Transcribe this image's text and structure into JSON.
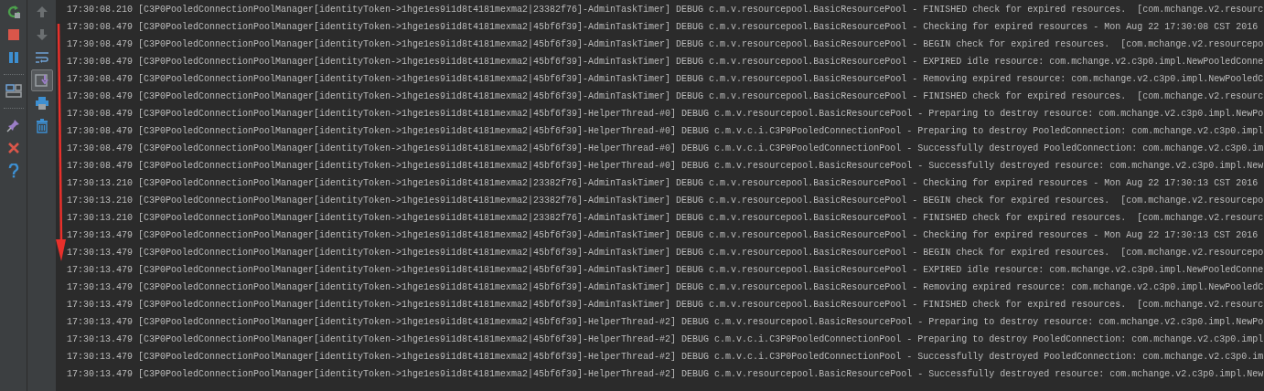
{
  "run_toolbar": [
    {
      "kind": "rerun"
    },
    {
      "kind": "stop"
    },
    {
      "kind": "pause"
    },
    {
      "kind": "separator"
    },
    {
      "kind": "layout"
    },
    {
      "kind": "separator"
    },
    {
      "kind": "pin"
    },
    {
      "kind": "close"
    },
    {
      "kind": "help"
    }
  ],
  "console_toolbar": [
    {
      "kind": "up",
      "disabled": true,
      "selected": false
    },
    {
      "kind": "down",
      "disabled": true,
      "selected": false
    },
    {
      "kind": "wrap",
      "disabled": false,
      "selected": false
    },
    {
      "kind": "scroll_end",
      "disabled": false,
      "selected": true
    },
    {
      "kind": "print",
      "disabled": false,
      "selected": false
    },
    {
      "kind": "trash",
      "disabled": false,
      "selected": false
    }
  ],
  "log_lines": [
    "17:30:08.210 [C3P0PooledConnectionPoolManager[identityToken->1hge1es9i1d8t4181mexma2|23382f76]-AdminTaskTimer] DEBUG c.m.v.resourcepool.BasicResourcePool - FINISHED check for expired resources.  [com.mchange.v2.resourc",
    "17:30:08.479 [C3P0PooledConnectionPoolManager[identityToken->1hge1es9i1d8t4181mexma2|45bf6f39]-AdminTaskTimer] DEBUG c.m.v.resourcepool.BasicResourcePool - Checking for expired resources - Mon Aug 22 17:30:08 CST 2016",
    "17:30:08.479 [C3P0PooledConnectionPoolManager[identityToken->1hge1es9i1d8t4181mexma2|45bf6f39]-AdminTaskTimer] DEBUG c.m.v.resourcepool.BasicResourcePool - BEGIN check for expired resources.  [com.mchange.v2.resourcepo",
    "17:30:08.479 [C3P0PooledConnectionPoolManager[identityToken->1hge1es9i1d8t4181mexma2|45bf6f39]-AdminTaskTimer] DEBUG c.m.v.resourcepool.BasicResourcePool - EXPIRED idle resource: com.mchange.v2.c3p0.impl.NewPooledConne",
    "17:30:08.479 [C3P0PooledConnectionPoolManager[identityToken->1hge1es9i1d8t4181mexma2|45bf6f39]-AdminTaskTimer] DEBUG c.m.v.resourcepool.BasicResourcePool - Removing expired resource: com.mchange.v2.c3p0.impl.NewPooledC",
    "17:30:08.479 [C3P0PooledConnectionPoolManager[identityToken->1hge1es9i1d8t4181mexma2|45bf6f39]-AdminTaskTimer] DEBUG c.m.v.resourcepool.BasicResourcePool - FINISHED check for expired resources.  [com.mchange.v2.resourc",
    "17:30:08.479 [C3P0PooledConnectionPoolManager[identityToken->1hge1es9i1d8t4181mexma2|45bf6f39]-HelperThread-#0] DEBUG c.m.v.resourcepool.BasicResourcePool - Preparing to destroy resource: com.mchange.v2.c3p0.impl.NewPo",
    "17:30:08.479 [C3P0PooledConnectionPoolManager[identityToken->1hge1es9i1d8t4181mexma2|45bf6f39]-HelperThread-#0] DEBUG c.m.v.c.i.C3P0PooledConnectionPool - Preparing to destroy PooledConnection: com.mchange.v2.c3p0.impl",
    "17:30:08.479 [C3P0PooledConnectionPoolManager[identityToken->1hge1es9i1d8t4181mexma2|45bf6f39]-HelperThread-#0] DEBUG c.m.v.c.i.C3P0PooledConnectionPool - Successfully destroyed PooledConnection: com.mchange.v2.c3p0.im",
    "17:30:08.479 [C3P0PooledConnectionPoolManager[identityToken->1hge1es9i1d8t4181mexma2|45bf6f39]-HelperThread-#0] DEBUG c.m.v.resourcepool.BasicResourcePool - Successfully destroyed resource: com.mchange.v2.c3p0.impl.New",
    "17:30:13.210 [C3P0PooledConnectionPoolManager[identityToken->1hge1es9i1d8t4181mexma2|23382f76]-AdminTaskTimer] DEBUG c.m.v.resourcepool.BasicResourcePool - Checking for expired resources - Mon Aug 22 17:30:13 CST 2016",
    "17:30:13.210 [C3P0PooledConnectionPoolManager[identityToken->1hge1es9i1d8t4181mexma2|23382f76]-AdminTaskTimer] DEBUG c.m.v.resourcepool.BasicResourcePool - BEGIN check for expired resources.  [com.mchange.v2.resourcepo",
    "17:30:13.210 [C3P0PooledConnectionPoolManager[identityToken->1hge1es9i1d8t4181mexma2|23382f76]-AdminTaskTimer] DEBUG c.m.v.resourcepool.BasicResourcePool - FINISHED check for expired resources.  [com.mchange.v2.resourc",
    "17:30:13.479 [C3P0PooledConnectionPoolManager[identityToken->1hge1es9i1d8t4181mexma2|45bf6f39]-AdminTaskTimer] DEBUG c.m.v.resourcepool.BasicResourcePool - Checking for expired resources - Mon Aug 22 17:30:13 CST 2016",
    "17:30:13.479 [C3P0PooledConnectionPoolManager[identityToken->1hge1es9i1d8t4181mexma2|45bf6f39]-AdminTaskTimer] DEBUG c.m.v.resourcepool.BasicResourcePool - BEGIN check for expired resources.  [com.mchange.v2.resourcepo",
    "17:30:13.479 [C3P0PooledConnectionPoolManager[identityToken->1hge1es9i1d8t4181mexma2|45bf6f39]-AdminTaskTimer] DEBUG c.m.v.resourcepool.BasicResourcePool - EXPIRED idle resource: com.mchange.v2.c3p0.impl.NewPooledConne",
    "17:30:13.479 [C3P0PooledConnectionPoolManager[identityToken->1hge1es9i1d8t4181mexma2|45bf6f39]-AdminTaskTimer] DEBUG c.m.v.resourcepool.BasicResourcePool - Removing expired resource: com.mchange.v2.c3p0.impl.NewPooledC",
    "17:30:13.479 [C3P0PooledConnectionPoolManager[identityToken->1hge1es9i1d8t4181mexma2|45bf6f39]-AdminTaskTimer] DEBUG c.m.v.resourcepool.BasicResourcePool - FINISHED check for expired resources.  [com.mchange.v2.resourc",
    "17:30:13.479 [C3P0PooledConnectionPoolManager[identityToken->1hge1es9i1d8t4181mexma2|45bf6f39]-HelperThread-#2] DEBUG c.m.v.resourcepool.BasicResourcePool - Preparing to destroy resource: com.mchange.v2.c3p0.impl.NewPo",
    "17:30:13.479 [C3P0PooledConnectionPoolManager[identityToken->1hge1es9i1d8t4181mexma2|45bf6f39]-HelperThread-#2] DEBUG c.m.v.c.i.C3P0PooledConnectionPool - Preparing to destroy PooledConnection: com.mchange.v2.c3p0.impl",
    "17:30:13.479 [C3P0PooledConnectionPoolManager[identityToken->1hge1es9i1d8t4181mexma2|45bf6f39]-HelperThread-#2] DEBUG c.m.v.c.i.C3P0PooledConnectionPool - Successfully destroyed PooledConnection: com.mchange.v2.c3p0.im",
    "17:30:13.479 [C3P0PooledConnectionPoolManager[identityToken->1hge1es9i1d8t4181mexma2|45bf6f39]-HelperThread-#2] DEBUG c.m.v.resourcepool.BasicResourcePool - Successfully destroyed resource: com.mchange.v2.c3p0.impl.New"
  ]
}
